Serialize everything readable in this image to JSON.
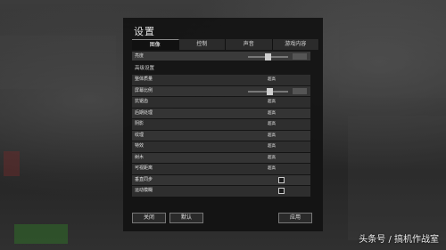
{
  "window": {
    "title": "设置"
  },
  "tabs": [
    {
      "label": "图像",
      "active": true
    },
    {
      "label": "控制",
      "active": false
    },
    {
      "label": "声音",
      "active": false
    },
    {
      "label": "游戏内容",
      "active": false
    }
  ],
  "top_slider": {
    "label": "亮度",
    "level": 0.5
  },
  "section_title": "高级设置",
  "settings": [
    {
      "label": "整体质量",
      "value": "超高",
      "type": "value"
    },
    {
      "label": "屏幕比例",
      "type": "slider",
      "level": 0.55
    },
    {
      "label": "抗锯齿",
      "value": "超高",
      "type": "value"
    },
    {
      "label": "后期处理",
      "value": "超高",
      "type": "value"
    },
    {
      "label": "阴影",
      "value": "超高",
      "type": "value"
    },
    {
      "label": "纹理",
      "value": "超高",
      "type": "value"
    },
    {
      "label": "特效",
      "value": "超高",
      "type": "value"
    },
    {
      "label": "树木",
      "value": "超高",
      "type": "value"
    },
    {
      "label": "可视距离",
      "value": "超高",
      "type": "value"
    },
    {
      "label": "垂直同步",
      "type": "checkbox",
      "checked": false
    },
    {
      "label": "运动模糊",
      "type": "checkbox",
      "checked": false
    }
  ],
  "footer": {
    "close_label": "关闭",
    "default_label": "默认",
    "apply_label": "应用"
  },
  "watermark": "头条号 / 搞机作战室"
}
